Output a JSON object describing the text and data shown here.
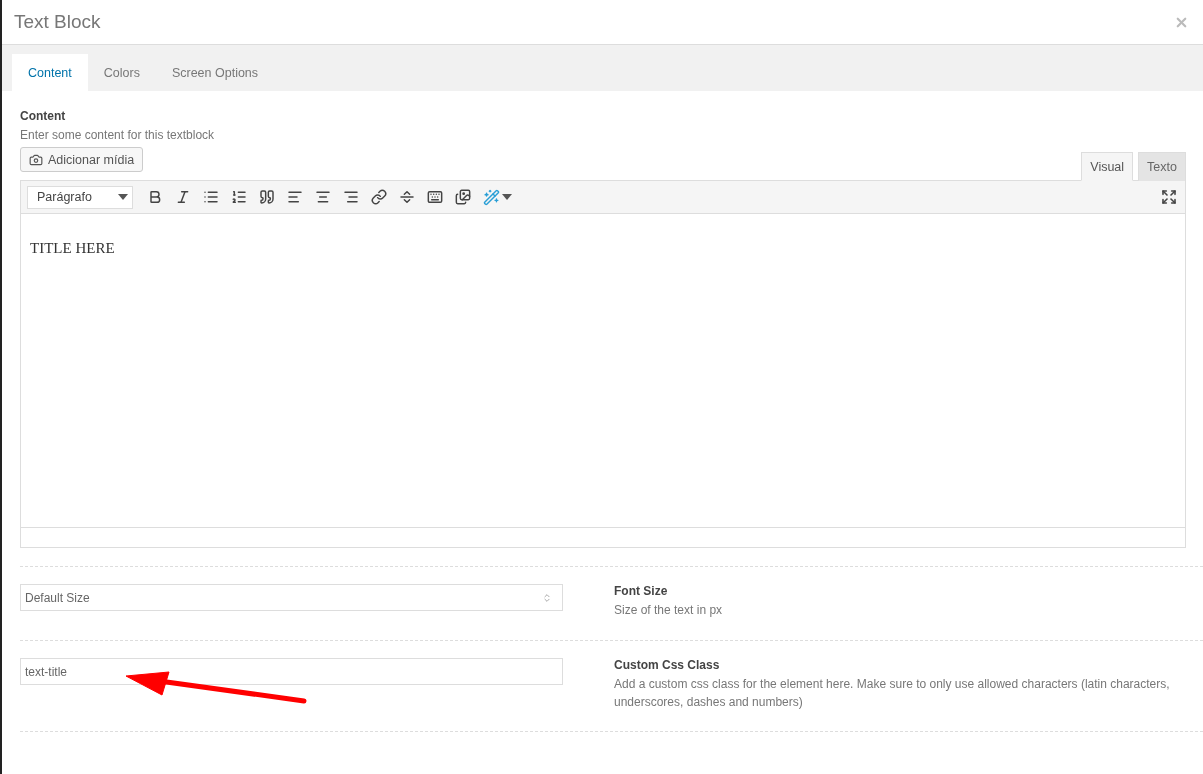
{
  "window": {
    "title": "Text Block"
  },
  "tabs": [
    {
      "label": "Content",
      "selected": true
    },
    {
      "label": "Colors",
      "selected": false
    },
    {
      "label": "Screen Options",
      "selected": false
    }
  ],
  "content_field": {
    "label": "Content",
    "description": "Enter some content for this textblock",
    "media_button": "Adicionar mídia",
    "editor_tabs": [
      {
        "label": "Visual",
        "selected": true
      },
      {
        "label": "Texto",
        "selected": false
      }
    ],
    "format_select": "Parágrafo",
    "text": "TITLE HERE"
  },
  "settings": [
    {
      "kind": "select",
      "value": "Default Size",
      "label": "Font Size",
      "description": "Size of the text in px"
    },
    {
      "kind": "input",
      "value": "text-title",
      "label": "Custom Css Class",
      "description": "Add a custom css class for the element here. Make sure to only use allowed characters (latin characters, underscores, dashes and numbers)"
    }
  ]
}
